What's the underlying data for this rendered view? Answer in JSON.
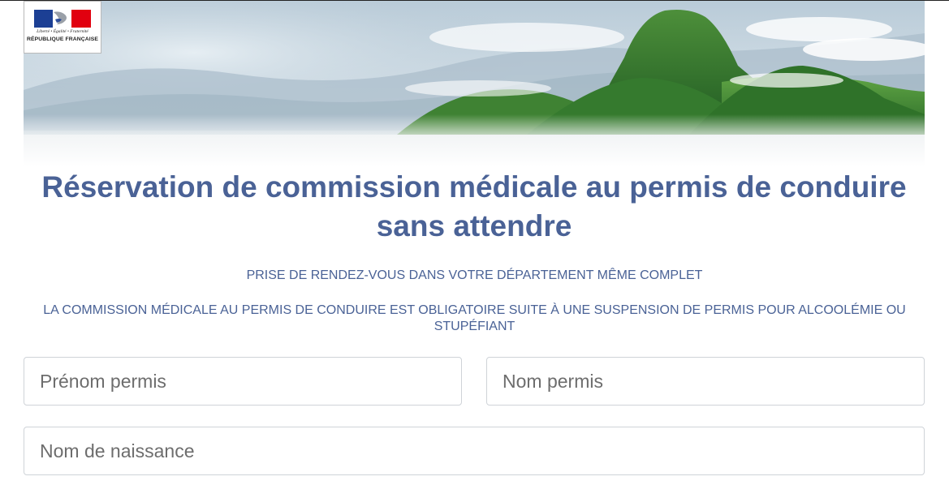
{
  "logo": {
    "motto": "Liberté • Égalité • Fraternité",
    "name": "RÉPUBLIQUE FRANÇAISE",
    "colors": {
      "blue": "#1c3f94",
      "white": "#ffffff",
      "red": "#e1000f"
    }
  },
  "banner": {
    "image": "volcanic-mountains-landscape"
  },
  "header": {
    "title": "Réservation de commission médicale au permis de conduire sans attendre",
    "subtitle": "PRISE DE RENDEZ-VOUS DANS VOTRE DÉPARTEMENT MÊME COMPLET",
    "notice": "LA COMMISSION MÉDICALE AU PERMIS DE CONDUIRE EST OBLIGATOIRE SUITE À UNE SUSPENSION DE PERMIS POUR ALCOOLÉMIE OU STUPÉFIANT"
  },
  "form": {
    "first_name": {
      "placeholder": "Prénom permis",
      "value": ""
    },
    "last_name": {
      "placeholder": "Nom permis",
      "value": ""
    },
    "birth_name": {
      "placeholder": "Nom de naissance",
      "value": ""
    }
  },
  "colors": {
    "heading": "#4a6296",
    "input_border": "#cfd3d8"
  }
}
